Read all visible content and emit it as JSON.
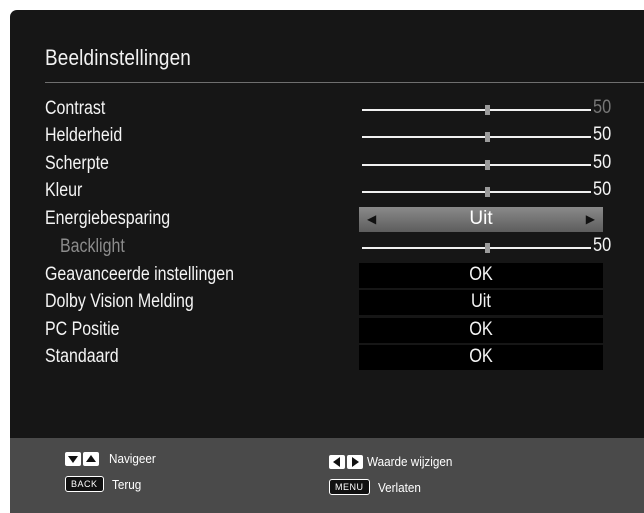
{
  "menu": {
    "title": "Beeldinstellingen",
    "items": [
      {
        "label": "Contrast",
        "type": "slider",
        "value": "50",
        "level": 0.5,
        "dimmed_value": true
      },
      {
        "label": "Helderheid",
        "type": "slider",
        "value": "50",
        "level": 0.5
      },
      {
        "label": "Scherpte",
        "type": "slider",
        "value": "50",
        "level": 0.5
      },
      {
        "label": "Kleur",
        "type": "slider",
        "value": "50",
        "level": 0.5
      },
      {
        "label": "Energiebesparing",
        "type": "selector",
        "value": "Uit"
      },
      {
        "label": "Backlight",
        "type": "slider",
        "value": "50",
        "level": 0.5,
        "dimmed_label": true
      },
      {
        "label": "Geavanceerde instellingen",
        "type": "button",
        "value": "OK"
      },
      {
        "label": "Dolby Vision Melding",
        "type": "button",
        "value": "Uit"
      },
      {
        "label": "PC Positie",
        "type": "button",
        "value": "OK"
      },
      {
        "label": "Standaard",
        "type": "button",
        "value": "OK"
      }
    ]
  },
  "footer": {
    "navigate": "Navigeer",
    "back_key": "BACK",
    "back": "Terug",
    "change_value": "Waarde wijzigen",
    "menu_key": "MENU",
    "exit": "Verlaten"
  },
  "colors": {
    "panel": "#161616",
    "footer": "#4a4a4a",
    "selected_row": "#7a7a7a"
  }
}
